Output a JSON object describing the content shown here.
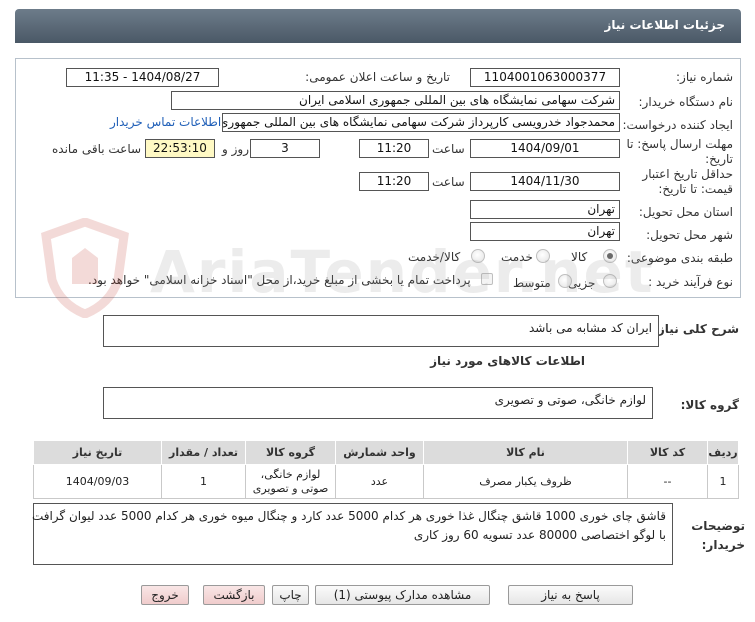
{
  "page": {
    "title": "جزئیات اطلاعات نیاز"
  },
  "form": {
    "need_number_label": "شماره نیاز:",
    "need_number": "1104001063000377",
    "announce_label": "تاریخ و ساعت اعلان عمومی:",
    "announce_value": "1404/08/27 - 11:35",
    "buyer_org_label": "نام دستگاه خریدار:",
    "buyer_org": "شرکت سهامی نمایشگاه های بین المللی جمهوری اسلامی ایران",
    "requester_label": "ایجاد کننده درخواست:",
    "requester": "محمدجواد خدرویسی کارپرداز شرکت سهامی نمایشگاه های بین المللی جمهوری",
    "contact_link": "اطلاعات تماس خریدار",
    "deadline_label": "مهلت ارسال پاسخ: تا تاریخ:",
    "deadline_date": "1404/09/01",
    "time_label": "ساعت",
    "deadline_time": "11:20",
    "days_value": "3",
    "days_label": "روز و",
    "remaining_time": "22:53:10",
    "remaining_label": "ساعت باقی مانده",
    "validity_label": "حداقل تاریخ اعتبار قیمت: تا تاریخ:",
    "validity_date": "1404/11/30",
    "validity_time": "11:20",
    "province_label": "استان محل تحویل:",
    "province": "تهران",
    "city_label": "شهر محل تحویل:",
    "city": "تهران",
    "category_label": "طبقه بندی موضوعی:",
    "category_options": [
      "کالا",
      "خدمت",
      "کالا/خدمت"
    ],
    "process_label": "نوع فرآیند خرید :",
    "process_options": [
      "جزیی",
      "متوسط"
    ],
    "payment_note": "پرداخت تمام یا بخشی از مبلغ خرید،از محل \"اسناد خزانه اسلامی\" خواهد بود."
  },
  "description": {
    "label": "شرح کلی نیاز:",
    "value": "ایران کد مشابه می باشد"
  },
  "goods": {
    "section_title": "اطلاعات کالاهای مورد نیاز",
    "group_label": "گروه کالا:",
    "group_value": "لوازم خانگی، صوتی و تصویری",
    "columns": [
      "ردیف",
      "کد کالا",
      "نام کالا",
      "واحد شمارش",
      "گروه کالا",
      "تعداد / مقدار",
      "تاریخ نیاز"
    ],
    "rows": [
      {
        "row": "1",
        "code": "--",
        "name": "ظروف یکبار مصرف",
        "unit": "عدد",
        "group": "لوازم خانگی، صوتی و تصویری",
        "qty": "1",
        "date": "1404/09/03"
      }
    ]
  },
  "buyer_notes": {
    "label": "توضیحات خریدار:",
    "line1": "قاشق چای خوری 1000 قاشق چنگال غذا خوری هر کدام 5000 عدد کارد و چنگال میوه خوری هر کدام 5000 عدد لیوان گرافت",
    "line2": "با لوگو اختصاصی 80000 عدد تسویه 60 روز کاری"
  },
  "buttons": {
    "reply": "پاسخ به نیاز",
    "attachments": "مشاهده مدارک پیوستی (1)",
    "print": "چاپ",
    "back": "بازگشت",
    "exit": "خروج"
  },
  "watermark": {
    "text": "AriaTender.net"
  },
  "colors": {
    "header": "#56636f",
    "link": "#1f5fb8",
    "remaining_bg": "#fff9c4"
  }
}
